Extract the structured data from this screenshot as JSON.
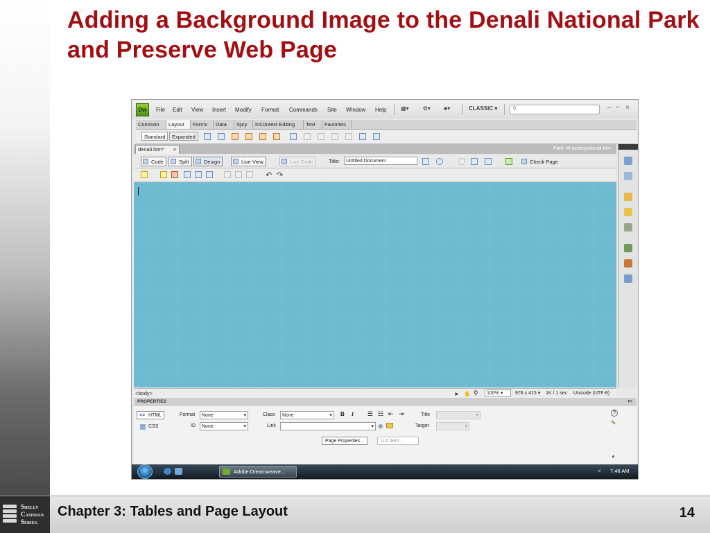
{
  "slide": {
    "title": "Adding a Background Image to the Denali National Park and Preserve Web Page",
    "footer_chapter": "Chapter 3: Tables and Page Layout",
    "page_number": "14",
    "logo_lines": [
      "Shelly",
      "Cashman",
      "Series."
    ]
  },
  "dreamweaver": {
    "app_logo": "Dw",
    "menus": [
      "File",
      "Edit",
      "View",
      "Insert",
      "Modify",
      "Format",
      "Commands",
      "Site",
      "Window",
      "Help"
    ],
    "workspace": "CLASSIC",
    "insert_tabs": [
      "Common",
      "Layout",
      "Forms",
      "Data",
      "Spry",
      "InContext Editing",
      "Text",
      "Favorites"
    ],
    "active_insert_tab": "Layout",
    "layout_modes": [
      "Standard",
      "Expanded"
    ],
    "document_tab": "denali.htm*",
    "close_glyph": "×",
    "path": "Path: M:\\testing\\denali.htm",
    "view_buttons": [
      "Code",
      "Split",
      "Design",
      "Live View",
      "Live Code"
    ],
    "title_label": "Title:",
    "document_title": "Untitled Document",
    "check_page": "Check Page",
    "status_tag": "<body>",
    "zoom": "100%",
    "window_size": "978 x 415",
    "doc_size": "1K / 1 sec",
    "encoding": "Unicode (UTF-8)",
    "design_bg_color": "#6ab9d0",
    "properties": {
      "header": "PROPERTIES",
      "html_button": "HTML",
      "css_button": "CSS",
      "format_label": "Format",
      "format_value": "None",
      "class_label": "Class",
      "class_value": "None",
      "id_label": "ID",
      "id_value": "None",
      "link_label": "Link",
      "bold": "B",
      "italic": "I",
      "title_label": "Title",
      "target_label": "Target",
      "page_properties": "Page Properties...",
      "list_item": "List Item..."
    },
    "taskbar": {
      "task_label": "Adobe Dreamweave...",
      "clock": "7:48 AM"
    }
  }
}
